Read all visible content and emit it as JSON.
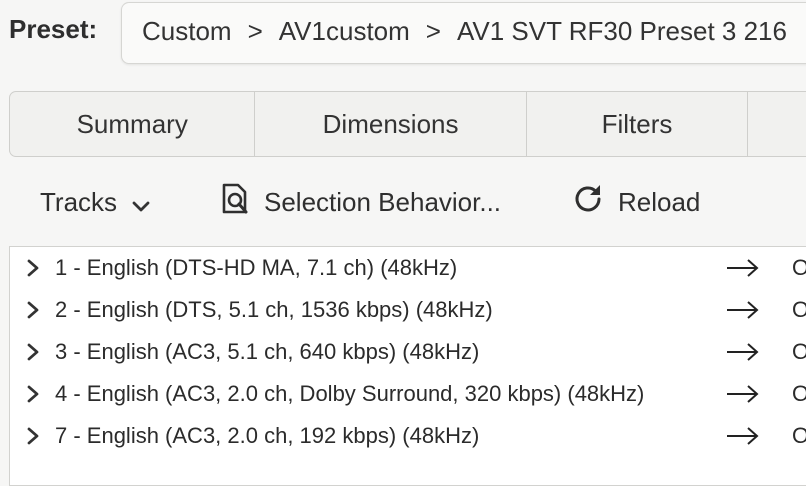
{
  "preset": {
    "label": "Preset:",
    "path": [
      "Custom",
      "AV1custom",
      "AV1 SVT RF30 Preset 3 216"
    ],
    "separator": ">"
  },
  "tabs": [
    {
      "label": "Summary"
    },
    {
      "label": "Dimensions"
    },
    {
      "label": "Filters"
    },
    {
      "label": ""
    }
  ],
  "toolbar": {
    "tracks_label": "Tracks",
    "tracks_icon": "chevron-down-icon",
    "selection_label": "Selection Behavior...",
    "selection_icon": "selection-behavior-icon",
    "reload_label": "Reload",
    "reload_icon": "reload-icon"
  },
  "tracks": [
    {
      "description": "1 - English (DTS-HD MA, 7.1 ch) (48kHz)",
      "output": "O"
    },
    {
      "description": "2 - English (DTS, 5.1 ch, 1536 kbps) (48kHz)",
      "output": "O"
    },
    {
      "description": "3 - English (AC3, 5.1 ch, 640 kbps) (48kHz)",
      "output": "O"
    },
    {
      "description": "4 - English (AC3, 2.0 ch, Dolby Surround, 320 kbps) (48kHz)",
      "output": "O"
    },
    {
      "description": "7 - English (AC3, 2.0 ch, 192 kbps) (48kHz)",
      "output": "O"
    }
  ]
}
